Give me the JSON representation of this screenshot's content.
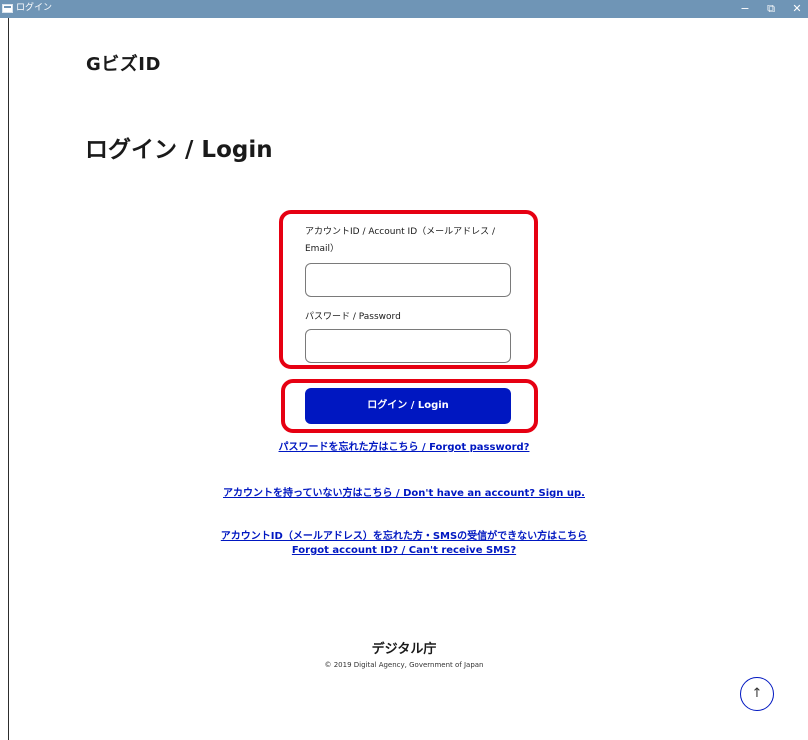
{
  "window": {
    "title": "ログイン",
    "minimize": "−",
    "restore": "⧉",
    "close": "✕"
  },
  "header": {
    "brand": "GビズID"
  },
  "main": {
    "title": "ログイン / Login",
    "account_label_line1": "アカウントID / Account ID（メールアドレス /",
    "account_label_line2": "Email）",
    "account_value": "",
    "password_label": "パスワード / Password",
    "password_value": "",
    "login_button": "ログイン / Login"
  },
  "links": {
    "forgot_password": "パスワードを忘れた方はこちら / Forgot password?",
    "sign_up": "アカウントを持っていない方はこちら / Don't have an account? Sign up.",
    "forgot_account_line1": "アカウントID（メールアドレス）を忘れた方・SMSの受信ができない方はこちら",
    "forgot_account_line2": "Forgot account ID? / Can't receive SMS?"
  },
  "footer": {
    "logo": "デジタル庁",
    "copyright": "© 2019 Digital Agency, Government of Japan",
    "scroll_top": "↑"
  },
  "colors": {
    "primary": "#0017c1",
    "highlight": "#e60012",
    "titlebar": "#6f95b6"
  }
}
